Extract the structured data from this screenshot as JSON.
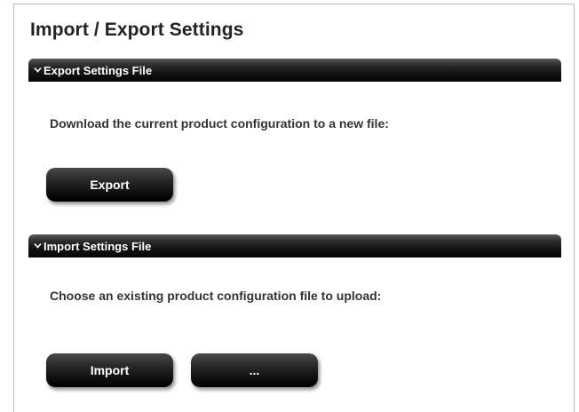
{
  "page": {
    "title": "Import / Export Settings"
  },
  "export_section": {
    "header": "Export Settings File",
    "description": "Download the current product configuration to a new file:",
    "export_button": "Export"
  },
  "import_section": {
    "header": "Import Settings File",
    "description": "Choose an existing product configuration file to upload:",
    "import_button": "Import",
    "browse_button": "..."
  },
  "icons": {
    "section_toggle": "chevron-down-icon"
  },
  "colors": {
    "section_bar": "#141414",
    "button": "#1a1a1a",
    "title_text": "#222222",
    "body_text": "#333333",
    "frame_border": "#b9b9b9"
  }
}
